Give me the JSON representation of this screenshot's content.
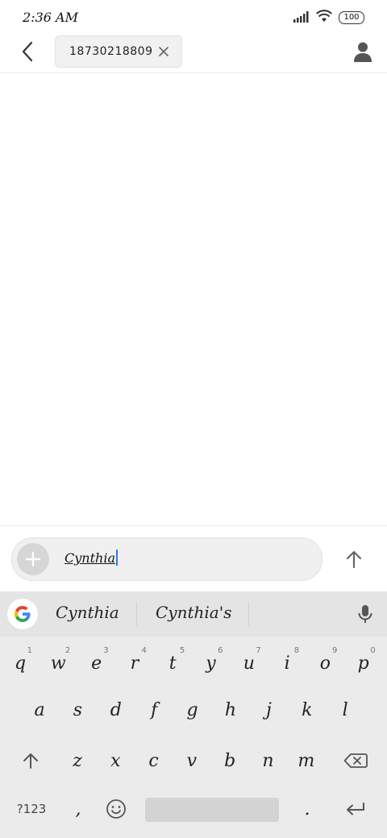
{
  "status": {
    "time": "2:36 AM",
    "battery": "100"
  },
  "header": {
    "recipient": "18730218809"
  },
  "composer": {
    "text": "Cynthia"
  },
  "keyboard": {
    "suggestions": [
      "Cynthia",
      "Cynthia's"
    ],
    "row1": [
      {
        "k": "q",
        "h": "1"
      },
      {
        "k": "w",
        "h": "2"
      },
      {
        "k": "e",
        "h": "3"
      },
      {
        "k": "r",
        "h": "4"
      },
      {
        "k": "t",
        "h": "5"
      },
      {
        "k": "y",
        "h": "6"
      },
      {
        "k": "u",
        "h": "7"
      },
      {
        "k": "i",
        "h": "8"
      },
      {
        "k": "o",
        "h": "9"
      },
      {
        "k": "p",
        "h": "0"
      }
    ],
    "row2": [
      "a",
      "s",
      "d",
      "f",
      "g",
      "h",
      "j",
      "k",
      "l"
    ],
    "row3": [
      "z",
      "x",
      "c",
      "v",
      "b",
      "n",
      "m"
    ],
    "symbols_label": "?123",
    "comma": ",",
    "period": "."
  },
  "colors": {
    "caret": "#2a7de1",
    "keyboard_bg": "#ebebeb"
  }
}
